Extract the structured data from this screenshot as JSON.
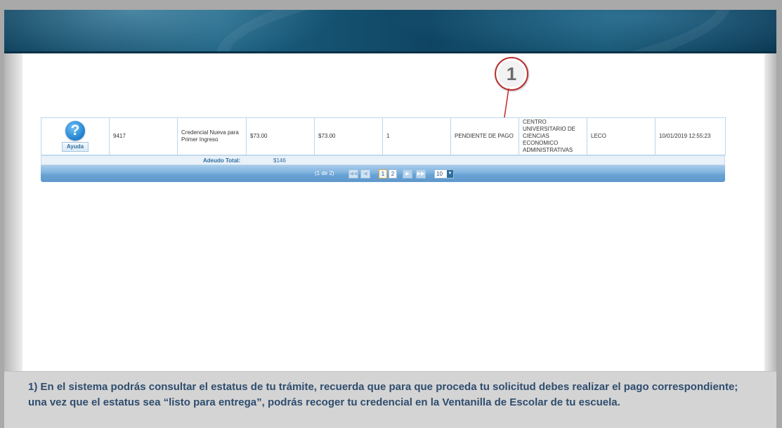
{
  "callout": {
    "number": "1"
  },
  "table": {
    "help_label": "Ayuda",
    "help_icon": "question-mark-icon",
    "row": {
      "folio": "9417",
      "concept": "Credencial Nueva para Primer Ingreso",
      "amount": "$73.00",
      "total": "$73.00",
      "quantity": "1",
      "status": "PENDIENTE DE PAGO",
      "school": "CENTRO UNIVERSITARIO DE CIENCIAS ECONOMICO ADMINISTRATIVAS",
      "campus": "LECO",
      "date": "10/01/2019 12:55:23"
    },
    "total_label": "Adeudo Total:",
    "total_value": "$146"
  },
  "paginator": {
    "info": "(1 de 2)",
    "first_icon": "first-page-icon",
    "prev_icon": "prev-page-icon",
    "pages": [
      "1",
      "2"
    ],
    "next_icon": "next-page-icon",
    "last_icon": "last-page-icon",
    "rows_per_page": "10"
  },
  "caption": {
    "text": "1) En el sistema podrás consultar el estatus de tu trámite, recuerda que para que proceda tu solicitud debes realizar el pago correspondiente; una vez que el estatus sea “listo para entrega”, podrás recoger tu credencial en la Ventanilla de Escolar de tu escuela."
  },
  "colors": {
    "banner": "#1b5f80",
    "paginator": "#6aa4d6",
    "callout_border": "#b83230",
    "caption_text": "#2f4d6e"
  }
}
